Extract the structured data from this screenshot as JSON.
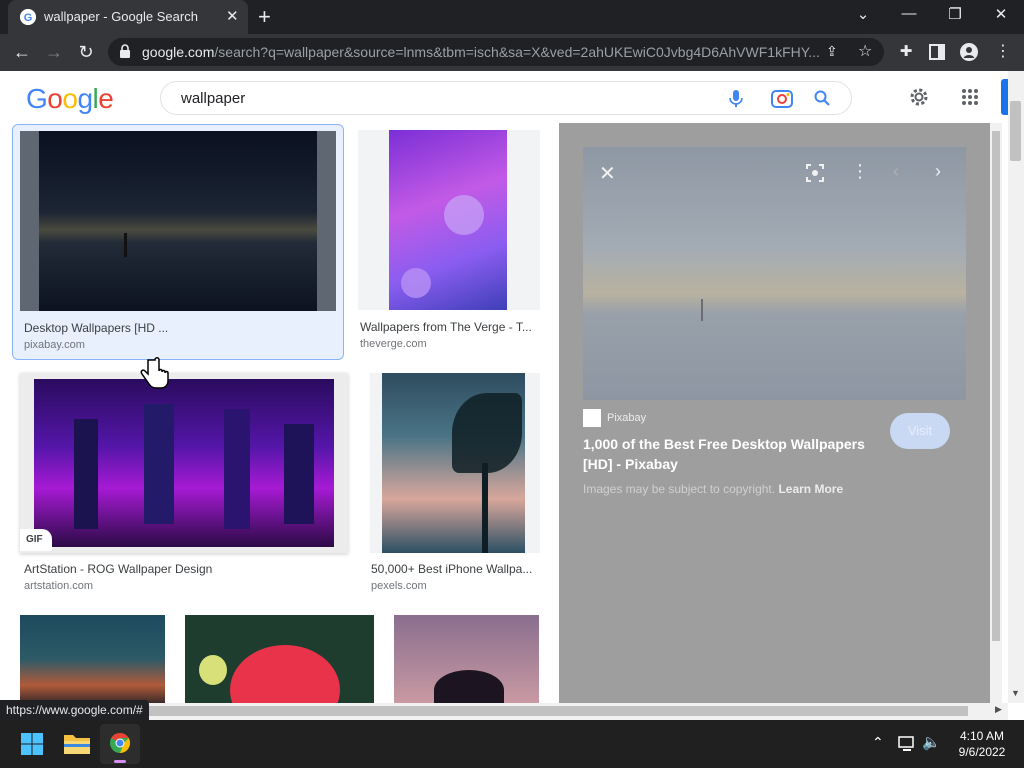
{
  "browser": {
    "tab_title": "wallpaper - Google Search",
    "url_host": "google.com",
    "url_rest": "/search?q=wallpaper&source=lnms&tbm=isch&sa=X&ved=2ahUKEwiC0Jvbg4D6AhVWF1kFHY...",
    "status_url": "https://www.google.com/#"
  },
  "google": {
    "logo": [
      "G",
      "o",
      "o",
      "g",
      "l",
      "e"
    ],
    "query": "wallpaper"
  },
  "results": [
    {
      "caption": "Desktop Wallpapers [HD ...",
      "source": "pixabay.com"
    },
    {
      "caption": "Wallpapers from The Verge - T...",
      "source": "theverge.com"
    },
    {
      "caption": "ArtStation - ROG Wallpaper Design",
      "source": "artstation.com",
      "badge": "GIF"
    },
    {
      "caption": "50,000+ Best iPhone Wallpa...",
      "source": "pexels.com"
    }
  ],
  "preview": {
    "site": "Pixabay",
    "title_line1": "1,000 of the Best Free Desktop Wallpapers",
    "title_line2": "[HD] - Pixabay",
    "visit_label": "Visit",
    "copyright": "Images may be subject to copyright.",
    "learn_more": "Learn More"
  },
  "taskbar": {
    "time": "4:10 AM",
    "date": "9/6/2022"
  },
  "colors": {
    "google_blue": "#4285f4",
    "google_red": "#ea4335",
    "google_yellow": "#fbbc05",
    "google_green": "#34a853",
    "selected_border": "#8ab4f8"
  }
}
